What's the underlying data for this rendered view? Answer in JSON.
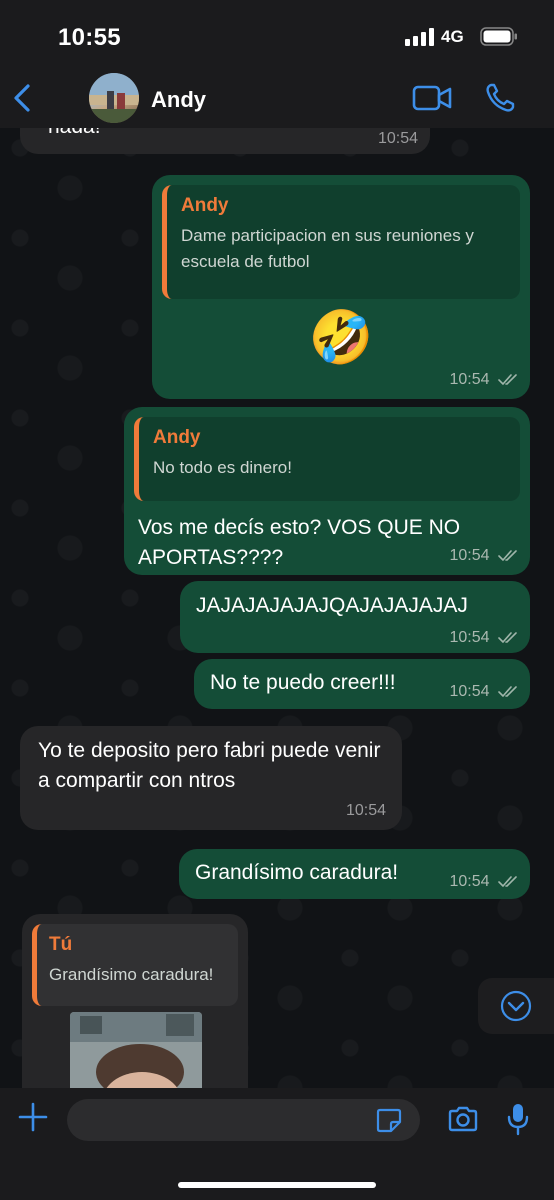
{
  "status_bar": {
    "time": "10:55",
    "network": "4G"
  },
  "header": {
    "contact_name": "Andy"
  },
  "messages": [
    {
      "text": "nada!",
      "time": "10:54"
    },
    {
      "quote_author": "Andy",
      "quote_text": "Dame participacion en sus reuniones y escuela de futbol",
      "emoji": "🤣",
      "time": "10:54"
    },
    {
      "quote_author": "Andy",
      "quote_text": "No todo es dinero!",
      "text": "Vos me decís esto? VOS QUE NO APORTAS????",
      "time": "10:54"
    },
    {
      "text": "JAJAJAJAJAJQAJAJAJAJAJ",
      "time": "10:54"
    },
    {
      "text": "No te puedo creer!!!",
      "time": "10:54"
    },
    {
      "text": "Yo te deposito pero fabri puede venir a compartir con ntros",
      "time": "10:54"
    },
    {
      "text": "Grandísimo caradura!",
      "time": "10:54"
    },
    {
      "quote_author": "Tú",
      "quote_text": "Grandísimo caradura!"
    }
  ],
  "composer": {
    "placeholder": ""
  },
  "colors": {
    "accent": "#3d8ee8",
    "outgoing_bubble": "#144d37",
    "incoming_bubble": "#262628",
    "quote_author": "#f07b3a"
  },
  "icons": [
    "back-chevron-icon",
    "video-call-icon",
    "phone-call-icon",
    "scroll-down-icon",
    "plus-icon",
    "sticker-icon",
    "camera-icon",
    "microphone-icon",
    "read-ticks-icon"
  ]
}
